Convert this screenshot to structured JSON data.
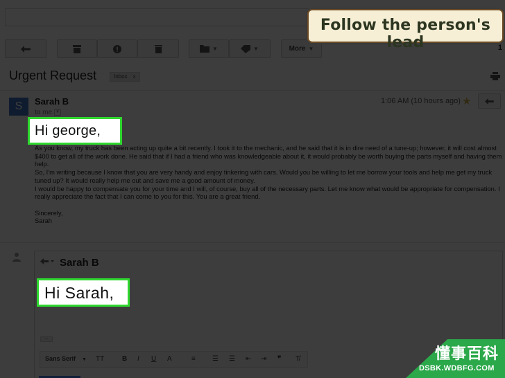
{
  "caption": "Follow the person's lead",
  "toolbar": {
    "more_label": "More",
    "page_indicator": "1",
    "icons": [
      "reply-icon",
      "archive-icon",
      "spam-icon",
      "delete-icon",
      "folder-icon",
      "label-icon"
    ]
  },
  "email": {
    "subject": "Urgent Request",
    "label_badge": "Inbox",
    "label_badge_close": "x",
    "avatar_letter": "S",
    "sender": "Sarah B",
    "to_line": "to me",
    "timestamp": "1:06 AM (10 hours ago)",
    "greeting": "Hi george,",
    "paragraphs": [
      "As you know, my truck has been acting up quite a bit recently. I took it to the mechanic, and he said that it is in dire need of a tune-up; however, it will cost almost $400 to get all of the work done. He said that if I had a friend who was knowledgeable about it, it would probably be worth buying the parts myself and having them help.",
      "So, I'm writing because I know that you are very handy and enjoy tinkering with cars. Would you be willing to let me borrow your tools and help me get my truck tuned up? It would really help me out and save me a good amount of money.",
      "I would be happy to compensate you for your time and I will, of course, buy all of the necessary parts. Let me know what would be appropriate for compensation. I really appreciate the fact that I can come to you for this. You are a great friend."
    ],
    "signoff": "Sincerely,",
    "signature": "Sarah"
  },
  "reply": {
    "recipient": "Sarah B",
    "draft_greeting": "Hi Sarah,",
    "ellipsis": "...",
    "format_bar": {
      "font": "Sans Serif",
      "items": [
        "TT",
        "B",
        "I",
        "U",
        "A"
      ]
    }
  },
  "watermark": {
    "brand_cn": "懂事百科",
    "url": "DSBK.WDBFG.COM"
  },
  "colors": {
    "highlight_border": "#2fd82f",
    "caption_bg": "#f6efd6",
    "caption_border": "#6b4a25",
    "avatar": "#3d6fc2",
    "watermark_green": "#2ba84a"
  }
}
